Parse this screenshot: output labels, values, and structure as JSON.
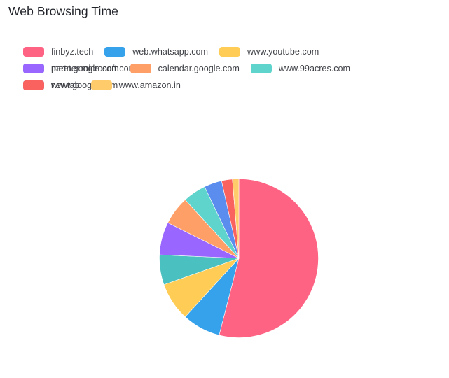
{
  "header": {
    "title": "Web Browsing Time"
  },
  "legend": {
    "position": "top-left",
    "rows": [
      [
        {
          "label": "finbyz.tech",
          "color": "#FF6384",
          "swatch_icon": "legend-color-swatch"
        },
        {
          "label": "web.whatsapp.com",
          "color": "#36A2EB",
          "swatch_icon": "legend-color-swatch"
        },
        {
          "label": "www.youtube.com",
          "color": "#FFCD56",
          "swatch_icon": "legend-color-swatch"
        },
        {
          "label": "partner.microsoft.com",
          "color": "#4BC0C0",
          "swatch_icon": "legend-color-swatch"
        }
      ],
      [
        {
          "label": "meet.google.com",
          "color": "#9966FF",
          "swatch_icon": "legend-color-swatch"
        },
        {
          "label": "calendar.google.com",
          "color": "#FF9F68",
          "swatch_icon": "legend-color-swatch"
        },
        {
          "label": "www.99acres.com",
          "color": "#5FD4CD",
          "swatch_icon": "legend-color-swatch"
        },
        {
          "label": "www.google.com",
          "color": "#5B8DEF",
          "swatch_icon": "legend-color-swatch"
        }
      ],
      [
        {
          "label": "newtab",
          "color": "#F9625E",
          "swatch_icon": "legend-color-swatch"
        },
        {
          "label": "www.amazon.in",
          "color": "#FFCB6B",
          "swatch_icon": "legend-color-swatch"
        }
      ]
    ]
  },
  "chart_data": {
    "type": "pie",
    "title": "Web Browsing Time",
    "xlabel": "",
    "ylabel": "",
    "legend_position": "top-left",
    "grid": false,
    "start_angle_deg": 0,
    "direction": "clockwise-from-12",
    "unit": "percent of browsing time",
    "categories": [
      "finbyz.tech",
      "web.whatsapp.com",
      "www.youtube.com",
      "partner.microsoft.com",
      "meet.google.com",
      "calendar.google.com",
      "www.99acres.com",
      "www.google.com",
      "newtab",
      "www.amazon.in"
    ],
    "values": [
      54.0,
      7.8,
      7.8,
      6.1,
      6.7,
      5.8,
      4.7,
      3.6,
      2.2,
      1.3
    ],
    "colors": [
      "#FF6384",
      "#36A2EB",
      "#FFCD56",
      "#4BC0C0",
      "#9966FF",
      "#FF9F68",
      "#5FD4CD",
      "#5B8DEF",
      "#F9625E",
      "#FFCB6B"
    ],
    "slices": [
      {
        "label": "finbyz.tech",
        "value": 54.0,
        "color": "#FF6384"
      },
      {
        "label": "web.whatsapp.com",
        "value": 7.8,
        "color": "#36A2EB"
      },
      {
        "label": "www.youtube.com",
        "value": 7.8,
        "color": "#FFCD56"
      },
      {
        "label": "partner.microsoft.com",
        "value": 6.1,
        "color": "#4BC0C0"
      },
      {
        "label": "meet.google.com",
        "value": 6.7,
        "color": "#9966FF"
      },
      {
        "label": "calendar.google.com",
        "value": 5.8,
        "color": "#FF9F68"
      },
      {
        "label": "www.99acres.com",
        "value": 4.7,
        "color": "#5FD4CD"
      },
      {
        "label": "www.google.com",
        "value": 3.6,
        "color": "#5B8DEF"
      },
      {
        "label": "newtab",
        "value": 2.2,
        "color": "#F9625E"
      },
      {
        "label": "www.amazon.in",
        "value": 1.3,
        "color": "#FFCB6B"
      }
    ]
  }
}
